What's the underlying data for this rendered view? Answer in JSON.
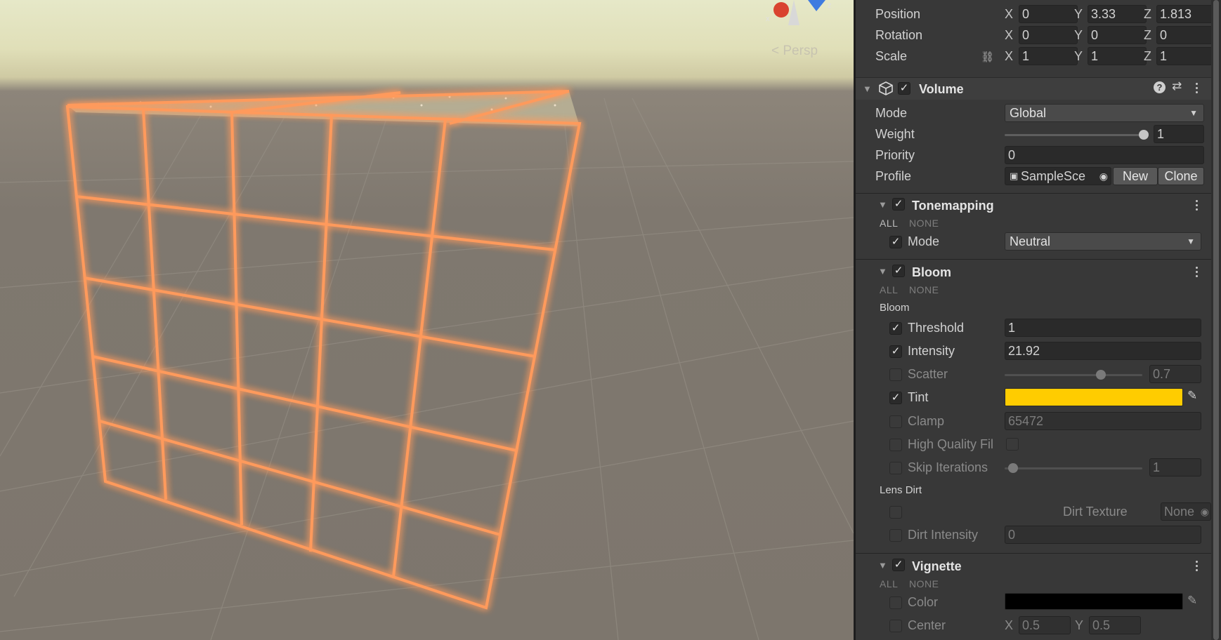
{
  "scene": {
    "view_label": "Persp",
    "gizmo_axes": [
      "x",
      "z"
    ]
  },
  "transform": {
    "position": {
      "label": "Position",
      "x": "0",
      "y": "3.33",
      "z": "1.813"
    },
    "rotation": {
      "label": "Rotation",
      "x": "0",
      "y": "0",
      "z": "0"
    },
    "scale": {
      "label": "Scale",
      "x": "1",
      "y": "1",
      "z": "1"
    },
    "axis_labels": {
      "x": "X",
      "y": "Y",
      "z": "Z"
    }
  },
  "volume": {
    "title": "Volume",
    "mode_label": "Mode",
    "mode_value": "Global",
    "weight_label": "Weight",
    "weight_value": "1",
    "weight_fraction": 1.0,
    "priority_label": "Priority",
    "priority_value": "0",
    "profile_label": "Profile",
    "profile_value": "SampleSce",
    "new_label": "New",
    "clone_label": "Clone"
  },
  "tonemapping": {
    "title": "Tonemapping",
    "all_label": "ALL",
    "none_label": "NONE",
    "mode_label": "Mode",
    "mode_value": "Neutral"
  },
  "bloom": {
    "title": "Bloom",
    "all_label": "ALL",
    "none_label": "NONE",
    "section_label": "Bloom",
    "threshold_label": "Threshold",
    "threshold_value": "1",
    "intensity_label": "Intensity",
    "intensity_value": "21.92",
    "scatter_label": "Scatter",
    "scatter_value": "0.7",
    "scatter_fraction": 0.7,
    "tint_label": "Tint",
    "tint_color": "#FFCC00",
    "clamp_label": "Clamp",
    "clamp_value": "65472",
    "hq_label": "High Quality Fil",
    "skip_label": "Skip Iterations",
    "skip_value": "1",
    "skip_fraction": 0.06,
    "lens_dirt_label": "Lens Dirt",
    "dirt_texture_label": "Dirt Texture",
    "dirt_texture_value": "None",
    "dirt_intensity_label": "Dirt Intensity",
    "dirt_intensity_value": "0"
  },
  "vignette": {
    "title": "Vignette",
    "all_label": "ALL",
    "none_label": "NONE",
    "color_label": "Color",
    "color_value": "#000000",
    "center_label": "Center",
    "center_x": "0.5",
    "center_y": "0.5"
  },
  "colors": {
    "glow": "#ff9a5c",
    "tint": "#FFCC00",
    "panel": "#383838"
  }
}
